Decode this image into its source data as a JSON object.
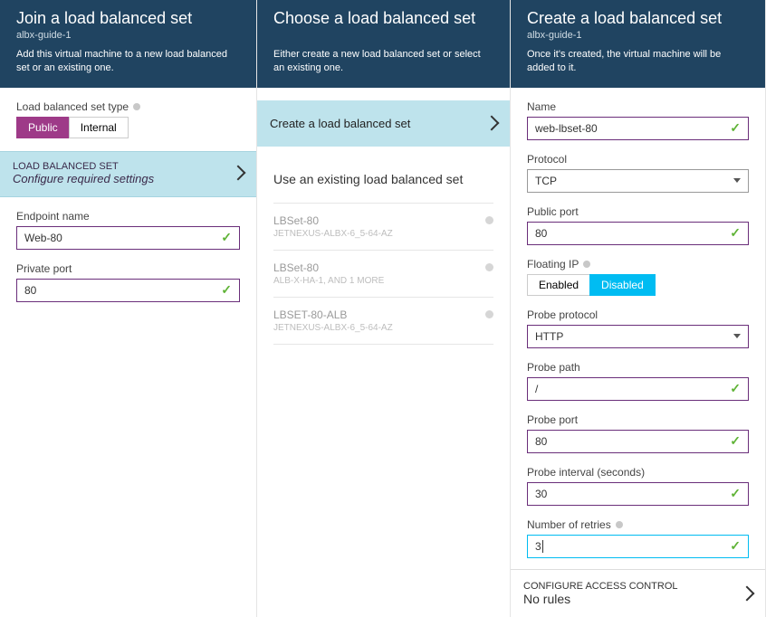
{
  "panel1": {
    "title": "Join a load balanced set",
    "sub": "albx-guide-1",
    "desc": "Add this virtual machine to a new load balanced set or an existing one.",
    "lb_type_label": "Load balanced set type",
    "lb_type_public": "Public",
    "lb_type_internal": "Internal",
    "banner_t1": "LOAD BALANCED SET",
    "banner_t2": "Configure required settings",
    "endpoint_label": "Endpoint name",
    "endpoint_value": "Web-80",
    "private_port_label": "Private port",
    "private_port_value": "80"
  },
  "panel2": {
    "title": "Choose a load balanced set",
    "desc": "Either create a new load balanced set or select an existing one.",
    "create_banner": "Create a load balanced set",
    "use_existing": "Use an existing load balanced set",
    "items": [
      {
        "name": "LBSet-80",
        "sub": "JETNEXUS-ALBX-6_5-64-AZ"
      },
      {
        "name": "LBSet-80",
        "sub": "ALB-X-HA-1, AND 1 MORE"
      },
      {
        "name": "LBSET-80-ALB",
        "sub": "JETNEXUS-ALBX-6_5-64-AZ"
      }
    ]
  },
  "panel3": {
    "title": "Create a load balanced set",
    "sub": "albx-guide-1",
    "desc": "Once it's created, the virtual machine will be added to it.",
    "name_label": "Name",
    "name_value": "web-lbset-80",
    "protocol_label": "Protocol",
    "protocol_value": "TCP",
    "public_port_label": "Public port",
    "public_port_value": "80",
    "floating_ip_label": "Floating IP",
    "floating_enabled": "Enabled",
    "floating_disabled": "Disabled",
    "probe_protocol_label": "Probe protocol",
    "probe_protocol_value": "HTTP",
    "probe_path_label": "Probe path",
    "probe_path_value": "/",
    "probe_port_label": "Probe port",
    "probe_port_value": "80",
    "probe_interval_label": "Probe interval (seconds)",
    "probe_interval_value": "30",
    "retries_label": "Number of retries",
    "retries_value": "3",
    "access_t1": "CONFIGURE ACCESS CONTROL",
    "access_t2": "No rules"
  }
}
